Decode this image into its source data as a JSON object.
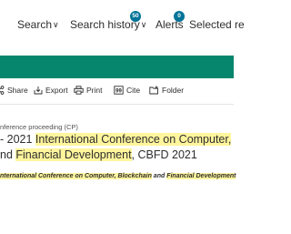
{
  "nav": {
    "search_label": "Search",
    "search_history_label": "Search history",
    "search_history_count": "50",
    "alerts_label": "Alerts",
    "alerts_count": "0",
    "selected_label": "Selected re"
  },
  "toolbar": {
    "share": "Share",
    "export": "Export",
    "print": "Print",
    "cite": "Cite",
    "folder": "Folder"
  },
  "document": {
    "type": "nference proceeding (CP)",
    "title_prefix": "- 2021 ",
    "title_hl1": "International Conference on Computer,",
    "title_l2_prefix": "nd ",
    "title_hl2": "Financial Development",
    "title_suffix": ", CBFD 2021",
    "source_hl1": "nternational Conference on Computer, Blockchain",
    "source_and": " and ",
    "source_hl2": "Financial Development"
  },
  "colors": {
    "brand_green": "#05866d",
    "badge_blue": "#007398",
    "highlight": "#fff59d"
  }
}
